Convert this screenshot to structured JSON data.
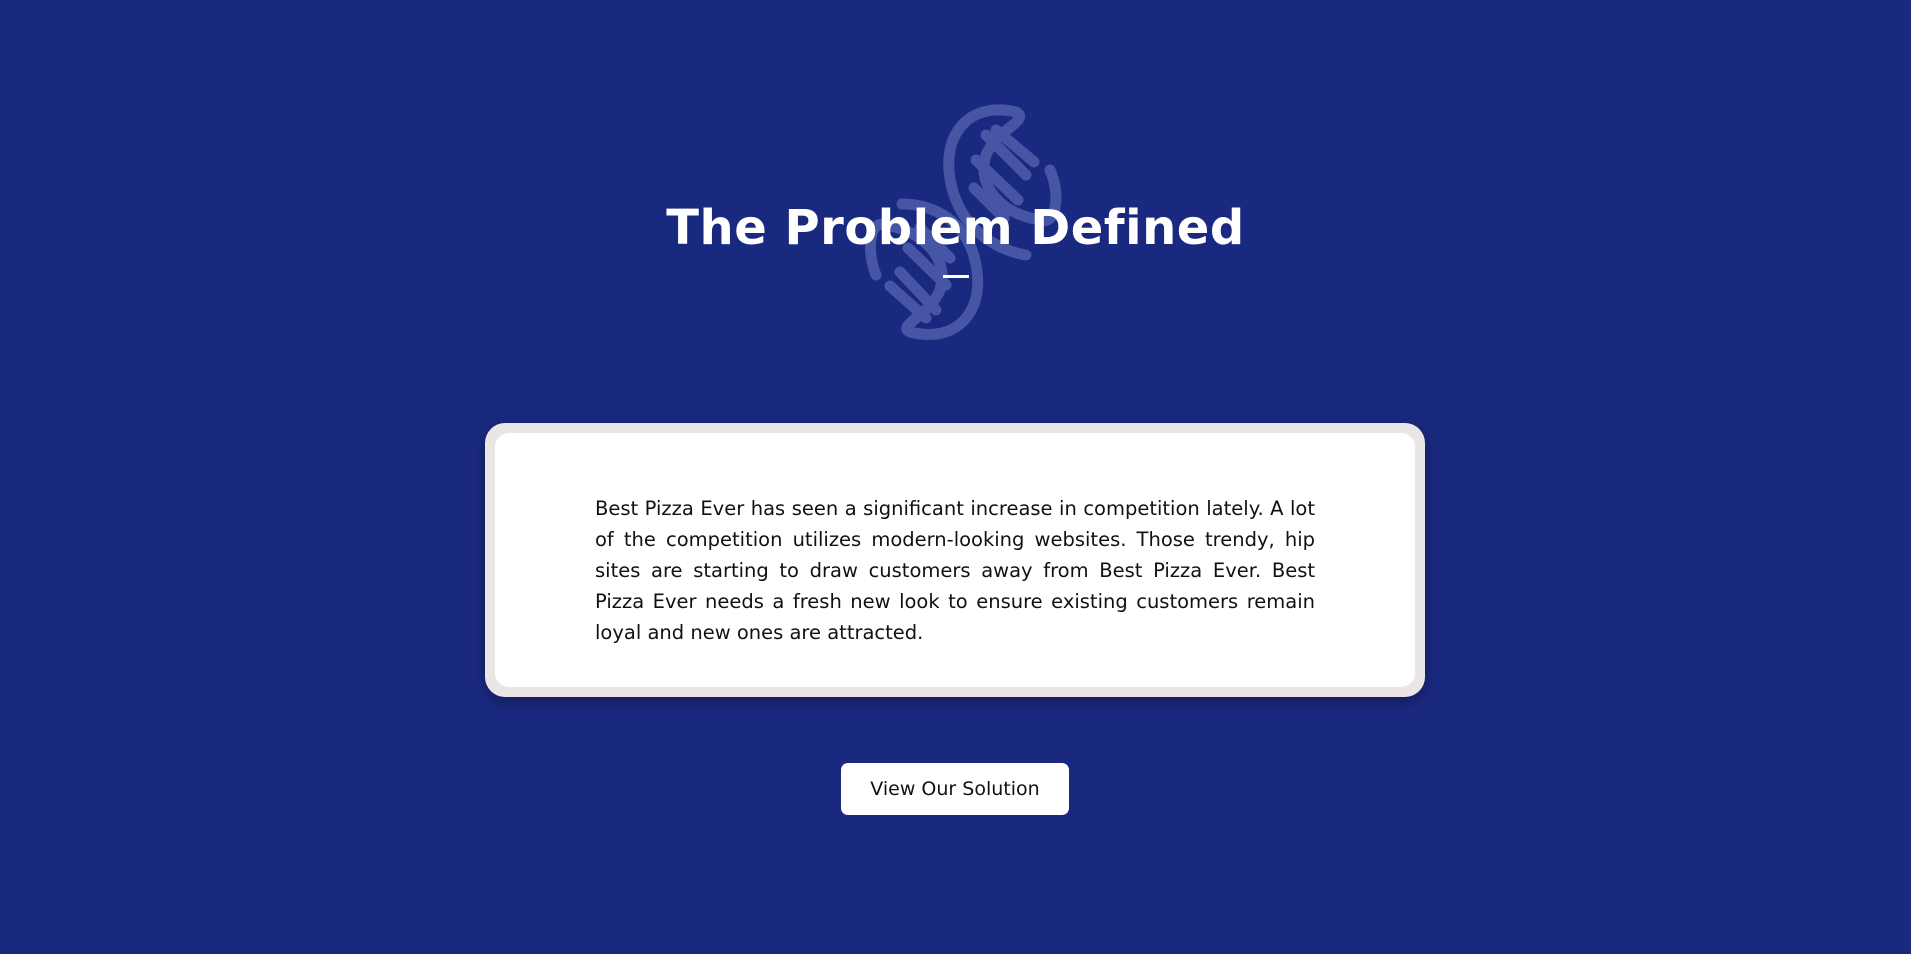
{
  "hero": {
    "title": "The Problem Defined",
    "background_color": "#1a2980",
    "decoration_icon": "dna-icon"
  },
  "problem_card": {
    "text": "Best Pizza Ever has seen a significant increase in competition lately. A lot of the competition utilizes modern-looking websites. Those trendy, hip sites are starting to draw customers away from Best Pizza Ever. Best Pizza Ever needs a fresh new look to ensure existing customers remain loyal and new ones are attracted."
  },
  "cta": {
    "label": "View Our Solution"
  }
}
